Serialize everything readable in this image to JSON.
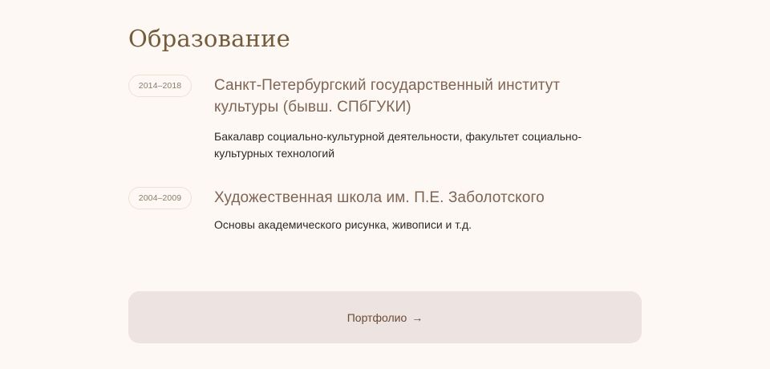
{
  "section": {
    "title": "Образование"
  },
  "education": [
    {
      "years": "2014–2018",
      "institution": "Санкт-Петербургский государственный институт культуры (бывш. СПбГУКИ)",
      "description": "Бакалавр социально-культурной деятельности, факультет социально-культурных технологий"
    },
    {
      "years": "2004–2009",
      "institution": "Художественная школа им. П.Е. Заболотского",
      "description": "Основы академического рисунка, живописи и т.д."
    }
  ],
  "portfolio_button": {
    "label": "Портфолио",
    "icon": "arrow-right-icon",
    "arrow": "→"
  },
  "colors": {
    "background": "#fdf8f4",
    "heading": "#735b3b",
    "title": "#7e6555",
    "button_bg": "#ede3e0",
    "badge_border": "#ece3d2"
  }
}
